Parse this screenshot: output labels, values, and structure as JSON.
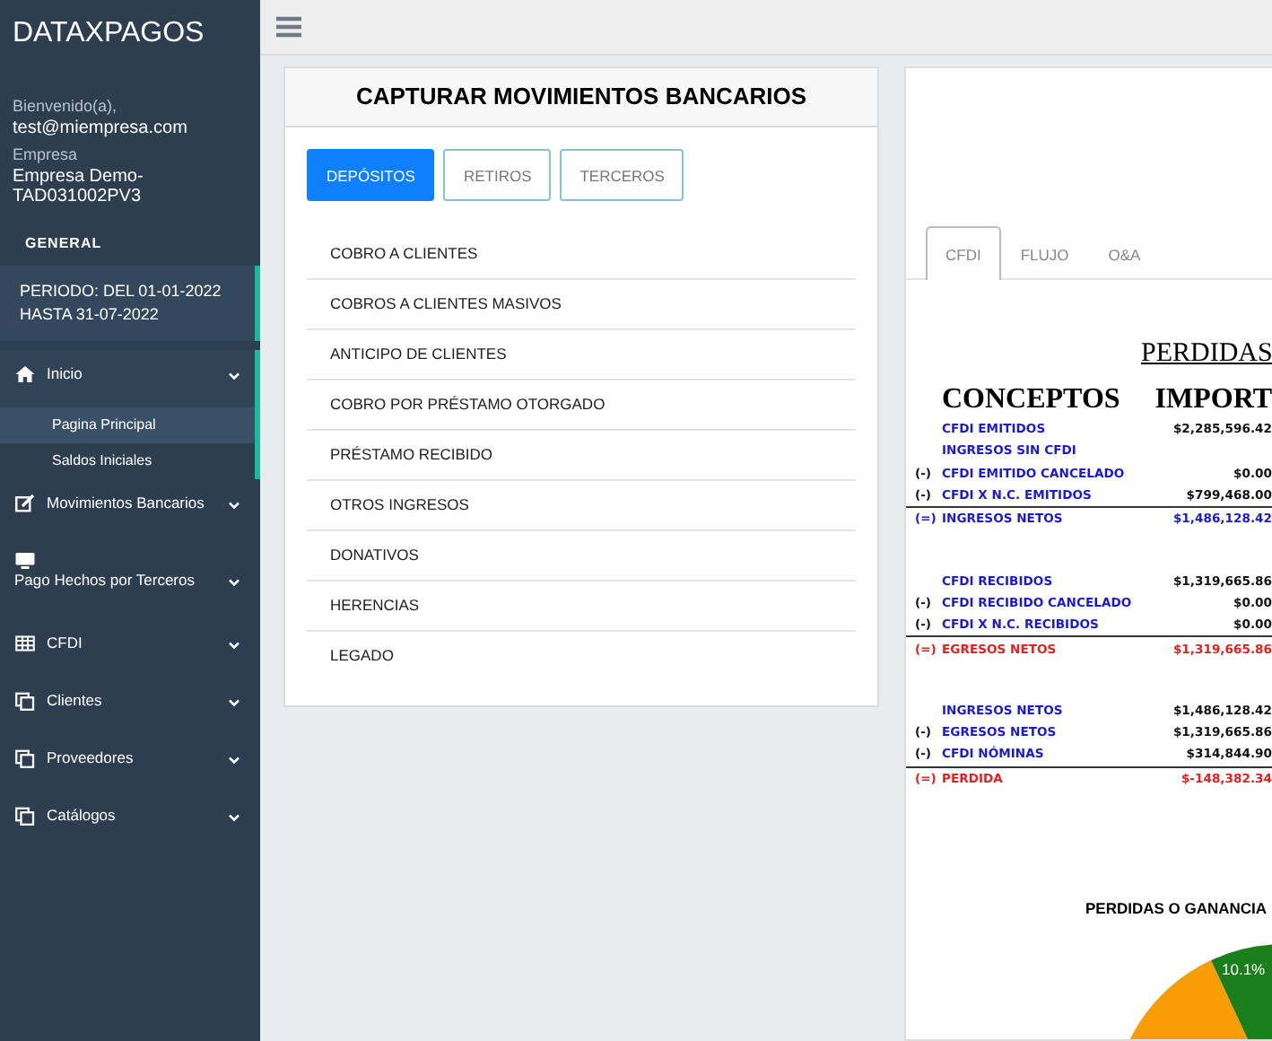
{
  "sidebar": {
    "brand": "DATAXPAGOS",
    "welcome_label": "Bienvenido(a),",
    "user": "test@miempresa.com",
    "company_label": "Empresa",
    "company": "Empresa Demo-TAD031002PV3",
    "section": "GENERAL",
    "period": "PERIODO: DEL 01-01-2022 HASTA 31-07-2022",
    "menu": [
      {
        "label": "Inicio",
        "selected": true,
        "children": [
          {
            "label": "Pagina Principal",
            "selected": true
          },
          {
            "label": "Saldos Iniciales",
            "selected": false
          }
        ]
      },
      {
        "label": "Movimientos Bancarios",
        "selected": false
      },
      {
        "label": "Pago Hechos por Terceros",
        "selected": false
      },
      {
        "label": "CFDI",
        "selected": false
      },
      {
        "label": "Clientes",
        "selected": false
      },
      {
        "label": "Proveedores",
        "selected": false
      },
      {
        "label": "Catálogos",
        "selected": false
      }
    ]
  },
  "capture": {
    "title": "CAPTURAR MOVIMIENTOS BANCARIOS",
    "tabs": [
      {
        "label": "DEPÓSITOS",
        "selected": true
      },
      {
        "label": "RETIROS",
        "selected": false
      },
      {
        "label": "TERCEROS",
        "selected": false
      }
    ],
    "items": [
      "COBRO A CLIENTES",
      "COBROS A CLIENTES MASIVOS",
      "ANTICIPO DE CLIENTES",
      "COBRO POR PRÉSTAMO OTORGADO",
      "PRÉSTAMO RECIBIDO",
      "OTROS INGRESOS",
      "DONATIVOS",
      "HERENCIAS",
      "LEGADO"
    ]
  },
  "report": {
    "tabs": [
      {
        "label": "CFDI",
        "selected": true
      },
      {
        "label": "FLUJO",
        "selected": false
      },
      {
        "label": "O&A",
        "selected": false
      }
    ],
    "title": "PERDIDAS",
    "col_concept": "CONCEPTOS",
    "col_amount": "IMPORT",
    "groups": [
      [
        {
          "kind": "line",
          "label": "CFDI EMITIDOS",
          "amount": "$2,285,596.42",
          "color": "#1a1ad0"
        },
        {
          "kind": "line",
          "label": "INGRESOS SIN CFDI",
          "color": "#1a1ad0"
        },
        {
          "kind": "line",
          "prefix": "(-)",
          "label": "CFDI EMITIDO CANCELADO",
          "amount": "$0.00",
          "color": "#1a1ad0"
        },
        {
          "kind": "line",
          "prefix": "(-)",
          "label": "CFDI X N.C. EMITIDOS",
          "amount": "$799,468.00",
          "color": "#1a1ad0"
        },
        {
          "kind": "total",
          "prefix": "(=)",
          "label": "INGRESOS NETOS",
          "amount": "$1,486,128.42",
          "color": "#1a1ad0"
        }
      ],
      [
        {
          "kind": "line",
          "label": "CFDI RECIBIDOS",
          "amount": "$1,319,665.86",
          "color": "#1a1ad0"
        },
        {
          "kind": "line",
          "prefix": "(-)",
          "label": "CFDI RECIBIDO CANCELADO",
          "amount": "$0.00",
          "color": "#1a1ad0"
        },
        {
          "kind": "line",
          "prefix": "(-)",
          "label": "CFDI X N.C. RECIBIDOS",
          "amount": "$0.00",
          "color": "#1a1ad0"
        },
        {
          "kind": "total",
          "prefix": "(=)",
          "label": "EGRESOS NETOS",
          "amount": "$1,319,665.86",
          "color": "#e8201c"
        }
      ],
      [
        {
          "kind": "line",
          "label": "INGRESOS NETOS",
          "amount": "$1,486,128.42",
          "color": "#1a1ad0"
        },
        {
          "kind": "line",
          "prefix": "(-)",
          "label": "EGRESOS NETOS",
          "amount": "$1,319,665.86",
          "color": "#1a1ad0"
        },
        {
          "kind": "line",
          "prefix": "(-)",
          "label": "CFDI NÓMINAS",
          "amount": "$314,844.90",
          "color": "#1a1ad0"
        },
        {
          "kind": "total",
          "prefix": "(=)",
          "label": "PERDIDA",
          "amount": "$-148,382.34",
          "color": "#e8201c"
        }
      ]
    ],
    "pie_title": "PERDIDAS O GANANCIA",
    "pie_label": "10.1%"
  }
}
